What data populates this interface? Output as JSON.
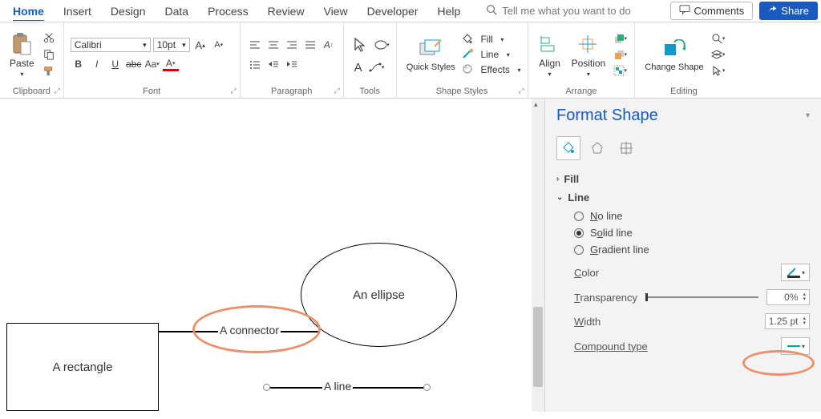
{
  "tabs": [
    "Home",
    "Insert",
    "Design",
    "Data",
    "Process",
    "Review",
    "View",
    "Developer",
    "Help"
  ],
  "activeTab": 0,
  "tellMe": "Tell me what you want to do",
  "topRight": {
    "comments": "Comments",
    "share": "Share"
  },
  "ribbon": {
    "clipboard": {
      "label": "Clipboard",
      "paste": "Paste"
    },
    "font": {
      "label": "Font",
      "name": "Calibri",
      "size": "10pt"
    },
    "paragraph": {
      "label": "Paragraph"
    },
    "tools": {
      "label": "Tools"
    },
    "shapeStyles": {
      "label": "Shape Styles",
      "quick": "Quick Styles",
      "fill": "Fill",
      "line": "Line",
      "effects": "Effects"
    },
    "arrange": {
      "label": "Arrange",
      "align": "Align",
      "position": "Position"
    },
    "editing": {
      "label": "Editing",
      "change": "Change Shape"
    }
  },
  "canvas": {
    "rectangle": "A rectangle",
    "ellipse": "An ellipse",
    "connector": "A connector",
    "line": "A line"
  },
  "pane": {
    "title": "Format Shape",
    "fill": "Fill",
    "line": "Line",
    "noLine": "No line",
    "solidLine": "Solid line",
    "gradientLine": "Gradient line",
    "color": "Color",
    "transparency": "Transparency",
    "transpVal": "0%",
    "width": "Width",
    "widthVal": "1.25 pt",
    "compound": "Compound type"
  }
}
